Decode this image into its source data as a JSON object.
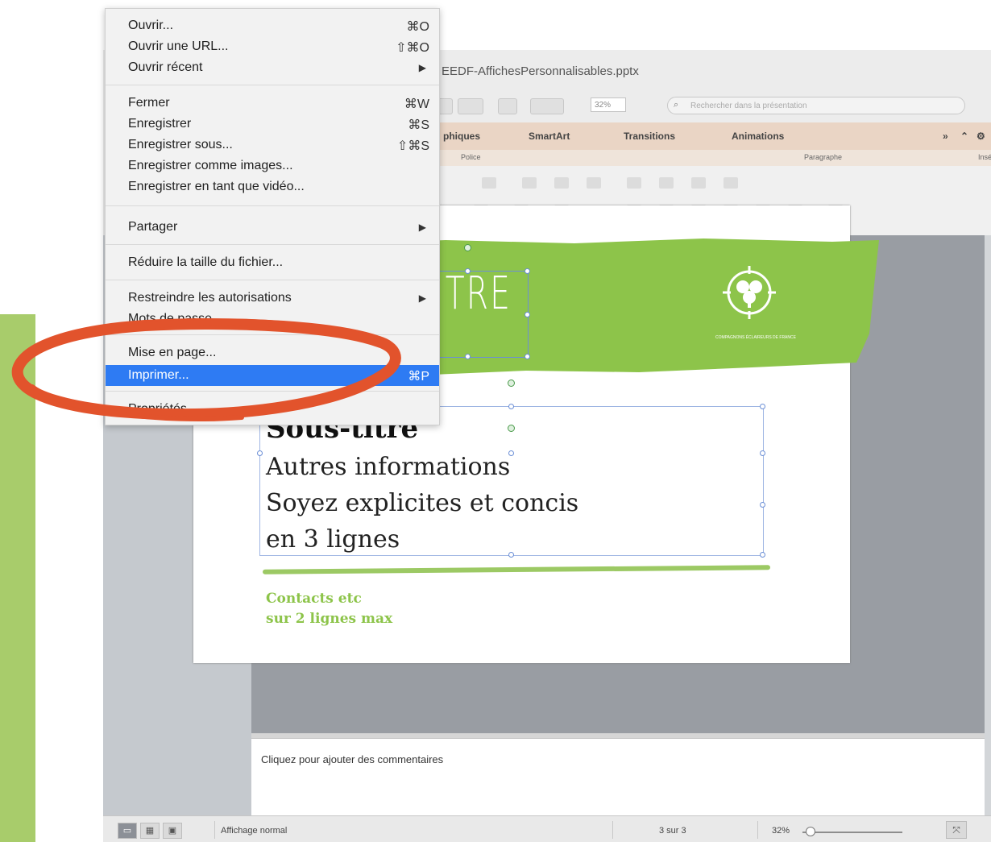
{
  "window": {
    "filename": "EEDF-AffichesPersonnalisables.pptx",
    "zoom_field": "32%",
    "search_placeholder": "Rechercher dans la présentation"
  },
  "ribbon": {
    "tabs": [
      "phiques",
      "SmartArt",
      "Transitions",
      "Animations"
    ],
    "more_label": "»",
    "collapse_label": "⌃",
    "settings_label": "⚙",
    "groups": [
      "Police",
      "Paragraphe",
      "Insé"
    ]
  },
  "slide": {
    "title": "TITRE",
    "logo_caption": "COMPAGNONS ÉCLAIREURS DE FRANCE",
    "subtitle": "Sous-titre",
    "line1": "Autres informations",
    "line2": "Soyez explicites et concis",
    "line3": "en 3 lignes",
    "contacts_line1": "Contacts etc",
    "contacts_line2": "sur 2 lignes max"
  },
  "notes": {
    "placeholder": "Cliquez pour ajouter des commentaires"
  },
  "statusbar": {
    "view_mode": "Affichage normal",
    "slide_position": "3 sur 3",
    "zoom": "32%",
    "zoom_value": 0.32
  },
  "file_menu": {
    "items": [
      {
        "label": "Ouvrir...",
        "shortcut": "⌘O"
      },
      {
        "label": "Ouvrir une URL...",
        "shortcut": "⇧⌘O"
      },
      {
        "label": "Ouvrir récent",
        "shortcut": "▶"
      },
      {
        "label": "Fermer",
        "shortcut": "⌘W"
      },
      {
        "label": "Enregistrer",
        "shortcut": "⌘S"
      },
      {
        "label": "Enregistrer sous...",
        "shortcut": "⇧⌘S"
      },
      {
        "label": "Enregistrer comme images...",
        "shortcut": ""
      },
      {
        "label": "Enregistrer en tant que vidéo...",
        "shortcut": ""
      },
      {
        "label": "Partager",
        "shortcut": "▶"
      },
      {
        "label": "Réduire la taille du fichier...",
        "shortcut": ""
      },
      {
        "label": "Restreindre les autorisations",
        "shortcut": "▶"
      },
      {
        "label": "Mots de passe...",
        "shortcut": ""
      },
      {
        "label": "Mise en page...",
        "shortcut": ""
      },
      {
        "label": "Imprimer...",
        "shortcut": "⌘P"
      },
      {
        "label": "Propriétés...",
        "shortcut": ""
      }
    ],
    "selected": "Imprimer..."
  },
  "colors": {
    "accent_green": "#8dc44a",
    "menu_selection": "#2e7bf3",
    "annotation": "#e2532c"
  },
  "icons": [
    "search-icon",
    "gear-icon",
    "chevron-right-icon",
    "normal-view-icon",
    "sorter-view-icon",
    "slideshow-icon",
    "fit-window-icon",
    "trefoil-logo"
  ]
}
